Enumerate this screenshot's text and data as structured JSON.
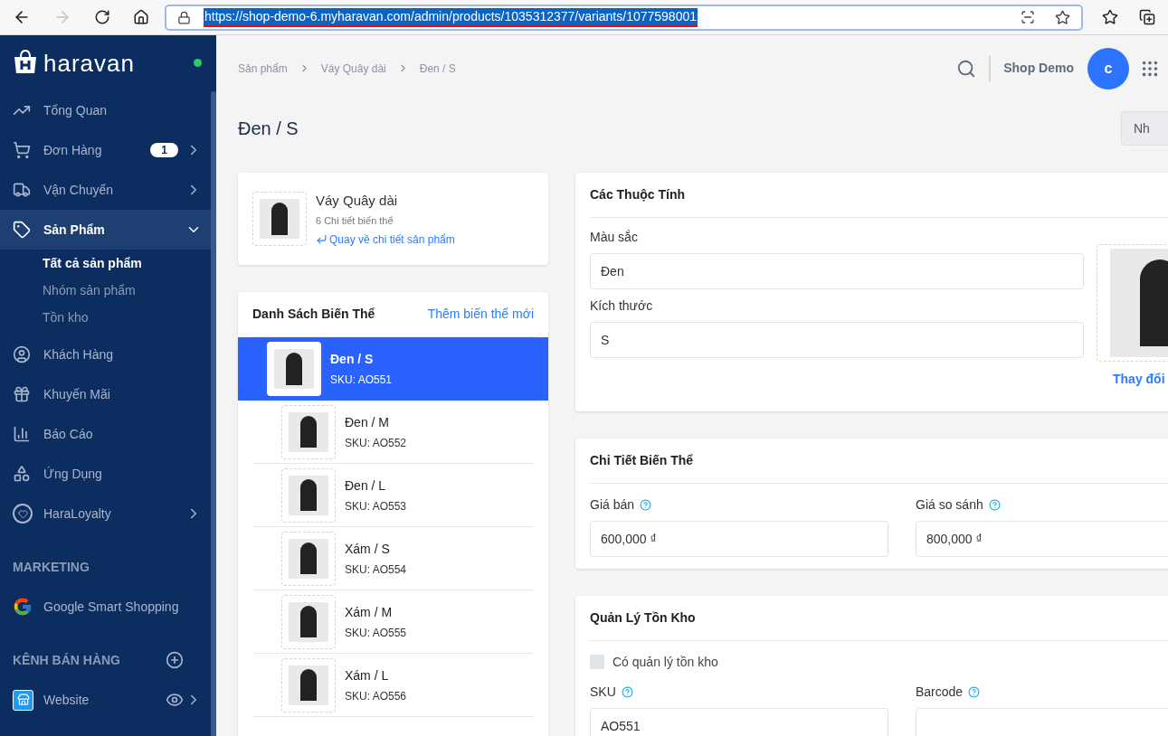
{
  "browser": {
    "url": "https://shop-demo-6.myharavan.com/admin/products/1035312377/variants/1077598001",
    "back_disabled": false,
    "forward_disabled": true
  },
  "sidebar": {
    "logo": "haravan",
    "items": [
      {
        "label": "Tổng Quan",
        "expandable": false,
        "expanded": false,
        "selected": false
      },
      {
        "label": "Đơn Hàng",
        "badge": "1",
        "expandable": true,
        "expanded": false,
        "selected": false
      },
      {
        "label": "Vận Chuyển",
        "expandable": true,
        "expanded": false,
        "selected": false
      },
      {
        "label": "Sản Phẩm",
        "expandable": true,
        "expanded": true,
        "selected": true,
        "children": [
          {
            "label": "Tất cả sản phẩm",
            "selected": true
          },
          {
            "label": "Nhóm sản phẩm",
            "selected": false
          },
          {
            "label": "Tồn kho",
            "selected": false
          }
        ]
      },
      {
        "label": "Khách Hàng",
        "expandable": false,
        "expanded": false,
        "selected": false
      },
      {
        "label": "Khuyến Mãi",
        "expandable": false,
        "expanded": false,
        "selected": false
      },
      {
        "label": "Báo Cáo",
        "expandable": false,
        "expanded": false,
        "selected": false
      },
      {
        "label": "Ứng Dụng",
        "expandable": false,
        "expanded": false,
        "selected": false
      },
      {
        "label": "HaraLoyalty",
        "expandable": true,
        "expanded": false,
        "selected": false
      }
    ],
    "sections": [
      {
        "title": "MARKETING",
        "items": [
          {
            "label": "Google Smart Shopping",
            "expandable": false
          }
        ]
      },
      {
        "title": "KÊNH BÁN HÀNG",
        "items": [
          {
            "label": "Website",
            "expandable": true
          }
        ]
      }
    ]
  },
  "header": {
    "breadcrumbs": [
      "Sản phẩm",
      "Váy Quây dài",
      "Đen / S"
    ],
    "shop_name": "Shop Demo",
    "avatar": "c"
  },
  "page_title": "Đen / S",
  "page_button": "Nh",
  "product": {
    "name": "Váy Quây dài",
    "variant_count": "6 Chi tiết biến thể",
    "back_link": "Quay về chi tiết sản phẩm"
  },
  "variants": {
    "title": "Danh Sách Biến Thể",
    "add_link": "Thêm biến thể mới",
    "items": [
      {
        "name": "Đen / S",
        "sku": "SKU: AO551",
        "selected": true
      },
      {
        "name": "Đen / M",
        "sku": "SKU: AO552",
        "selected": false
      },
      {
        "name": "Đen / L",
        "sku": "SKU: AO553",
        "selected": false
      },
      {
        "name": "Xám / S",
        "sku": "SKU: AO554",
        "selected": false
      },
      {
        "name": "Xám / M",
        "sku": "SKU: AO555",
        "selected": false
      },
      {
        "name": "Xám / L",
        "sku": "SKU: AO556",
        "selected": false
      }
    ]
  },
  "attributes": {
    "title": "Các Thuộc Tính",
    "fields": [
      {
        "label": "Màu sắc",
        "value": "Đen"
      },
      {
        "label": "Kích thước",
        "value": "S"
      }
    ],
    "image_action": "Thay đổi"
  },
  "details": {
    "title": "Chi Tiết Biến Thể",
    "fields": [
      {
        "label": "Giá bán",
        "value": "600,000 ₫"
      },
      {
        "label": "Giá so sánh",
        "value": "800,000 ₫"
      }
    ]
  },
  "inventory": {
    "title": "Quản Lý Tồn Kho",
    "checkbox": {
      "label": "Có quản lý tồn kho",
      "checked": false
    },
    "fields": [
      {
        "label": "SKU",
        "value": "AO551"
      },
      {
        "label": "Barcode"
      }
    ]
  }
}
